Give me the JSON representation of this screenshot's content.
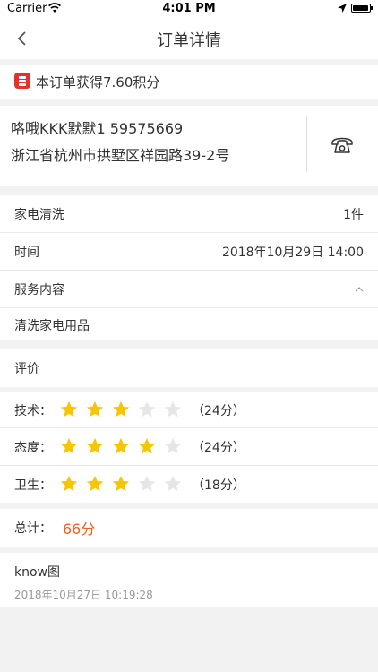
{
  "status_bar": {
    "carrier": "Carrier",
    "time": "4:01 PM"
  },
  "nav": {
    "title": "订单详情"
  },
  "points_banner": {
    "text": "本订单获得7.60积分",
    "icon_color": "#e0332d"
  },
  "contact": {
    "name_phone": "咯哦KKK默默1   59575669",
    "address": "浙江省杭州市拱墅区祥园路39-2号"
  },
  "order": {
    "service_label": "家电清洗",
    "service_qty": "1件",
    "time_label": "时间",
    "time_value": "2018年10月29日 14:00",
    "content_label": "服务内容",
    "content_value": "清洗家电用品"
  },
  "review": {
    "title": "评价",
    "ratings": [
      {
        "label": "技术：",
        "stars": 3,
        "max": 5,
        "score": "（24分）"
      },
      {
        "label": "态度：",
        "stars": 4,
        "max": 5,
        "score": "（24分）"
      },
      {
        "label": "卫生：",
        "stars": 3,
        "max": 5,
        "score": "（18分）"
      }
    ],
    "total_label": "总计：",
    "total_value": "66分",
    "total_color": "#e8631c",
    "star_color": "#f7c600",
    "star_empty_color": "#e6e6e6",
    "comment": "know图",
    "comment_time": "2018年10月27日 10:19:28"
  }
}
